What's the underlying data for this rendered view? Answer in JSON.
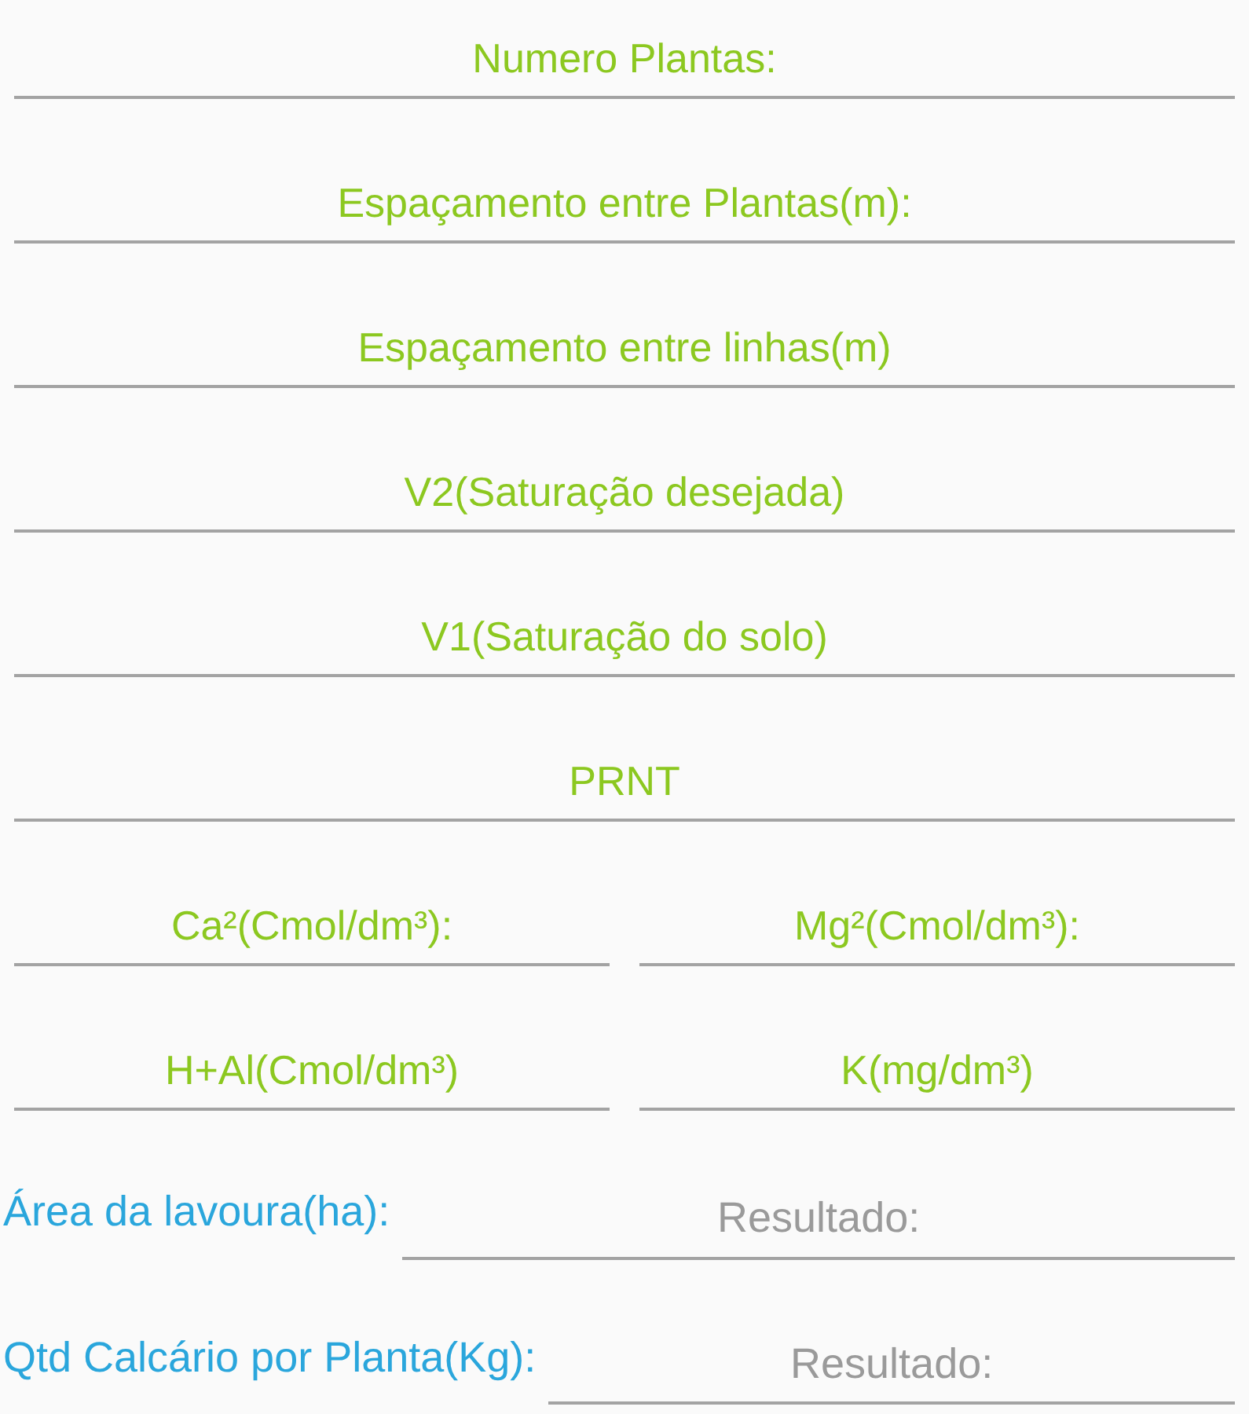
{
  "input_rows": [
    [
      {
        "placeholder": "Numero Plantas:"
      }
    ],
    [
      {
        "placeholder": "Espaçamento entre Plantas(m):"
      }
    ],
    [
      {
        "placeholder": "Espaçamento entre linhas(m)"
      }
    ],
    [
      {
        "placeholder": "V2(Saturação desejada)"
      }
    ],
    [
      {
        "placeholder": "V1(Saturação do solo)"
      }
    ],
    [
      {
        "placeholder": "PRNT"
      }
    ],
    [
      {
        "placeholder": "Ca²(Cmol/dm³):"
      },
      {
        "placeholder": "Mg²(Cmol/dm³):"
      }
    ],
    [
      {
        "placeholder": "H+Al(Cmol/dm³)"
      },
      {
        "placeholder": "K(mg/dm³)"
      }
    ]
  ],
  "results": [
    {
      "label": "Área da lavoura(ha):",
      "placeholder": "Resultado:"
    },
    {
      "label": "Qtd Calcário por Planta(Kg):",
      "placeholder": "Resultado:"
    }
  ]
}
